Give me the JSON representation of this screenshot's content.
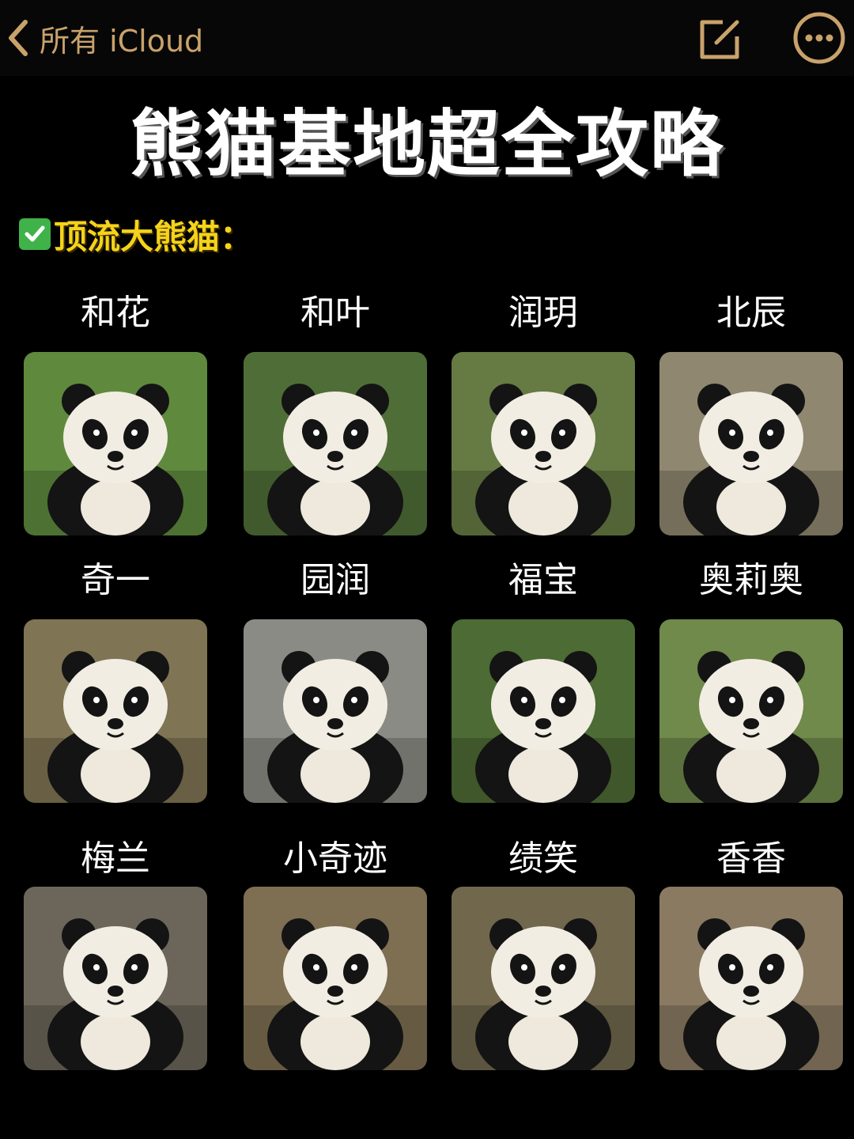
{
  "nav": {
    "back_label": "所有 iCloud",
    "accent_color": "#c9a26b"
  },
  "title": "熊猫基地超全攻略",
  "section": {
    "heading": "顶流大熊猫：",
    "heading_color": "#f5d31a",
    "check_color": "#3fb24a"
  },
  "pandas": [
    {
      "name": "和花",
      "icon": "panda-photo",
      "bg": "#5f8a3e"
    },
    {
      "name": "和叶",
      "icon": "panda-photo",
      "bg": "#4f6e37"
    },
    {
      "name": "润玥",
      "icon": "panda-photo",
      "bg": "#667a44"
    },
    {
      "name": "北辰",
      "icon": "panda-photo",
      "bg": "#8f8770"
    },
    {
      "name": "奇一",
      "icon": "panda-photo",
      "bg": "#7f7554"
    },
    {
      "name": "园润",
      "icon": "panda-photo",
      "bg": "#8b8b86"
    },
    {
      "name": "福宝",
      "icon": "panda-photo",
      "bg": "#4d6b34"
    },
    {
      "name": "奥莉奥",
      "icon": "panda-photo",
      "bg": "#6f8a4b"
    },
    {
      "name": "梅兰",
      "icon": "panda-photo",
      "bg": "#6c665a"
    },
    {
      "name": "小奇迹",
      "icon": "panda-photo",
      "bg": "#7e6e52"
    },
    {
      "name": "绩笑",
      "icon": "panda-photo",
      "bg": "#70674d"
    },
    {
      "name": "香香",
      "icon": "panda-photo",
      "bg": "#8a7a62"
    }
  ]
}
